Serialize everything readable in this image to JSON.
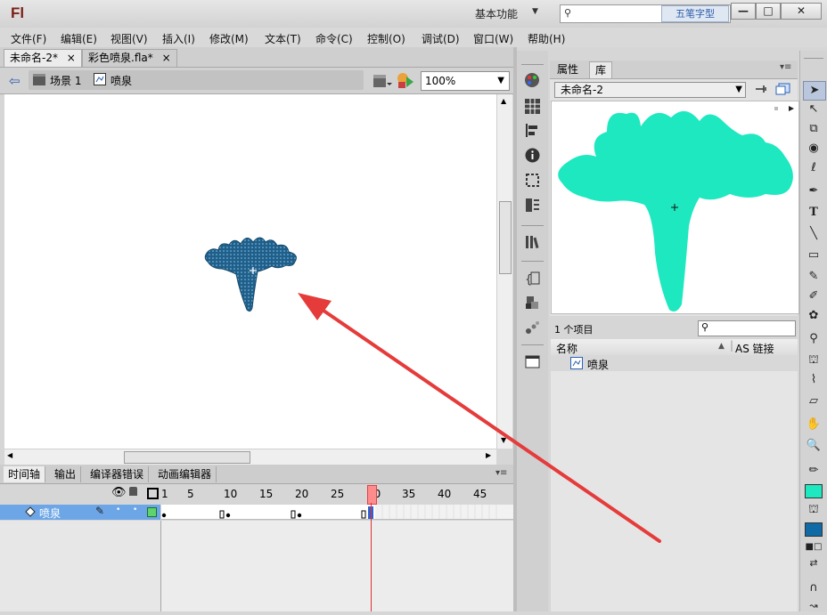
{
  "app": {
    "logo": "Fl",
    "workspace": "基本功能",
    "watermark": "五笔字型"
  },
  "window_buttons": {
    "minimize": "—",
    "maximize": "□",
    "close": "✕"
  },
  "menu": [
    "文件(F)",
    "编辑(E)",
    "视图(V)",
    "插入(I)",
    "修改(M)",
    "文本(T)",
    "命令(C)",
    "控制(O)",
    "调试(D)",
    "窗口(W)",
    "帮助(H)"
  ],
  "doc_tabs": [
    {
      "label": "未命名-2*",
      "close": "×"
    },
    {
      "label": "彩色喷泉.fla*",
      "close": "×"
    }
  ],
  "editbar": {
    "scene": "场景 1",
    "symbol": "喷泉",
    "zoom": "100%"
  },
  "timeline": {
    "tabs": [
      "时间轴",
      "输出",
      "编译器错误",
      "动画编辑器"
    ],
    "frame_numbers": [
      "1",
      "5",
      "10",
      "15",
      "20",
      "25",
      "30",
      "35",
      "40",
      "45"
    ],
    "layer_name": "喷泉",
    "playhead_frame": 30
  },
  "panel": {
    "tabs": [
      "属性",
      "库"
    ],
    "library_name": "未命名-2",
    "item_count": "1 个项目",
    "col_name": "名称",
    "col_linkage": "AS 链接",
    "item": "喷泉"
  },
  "colors": {
    "preview_fill": "#1ee8c0",
    "stage_symbol": "#1f5f8a",
    "stroke_swatch": "#1ee8c0",
    "fill_swatch": "#0f6aa6",
    "annotation_arrow": "#e53b3b",
    "playhead": "#ff7a7a"
  }
}
